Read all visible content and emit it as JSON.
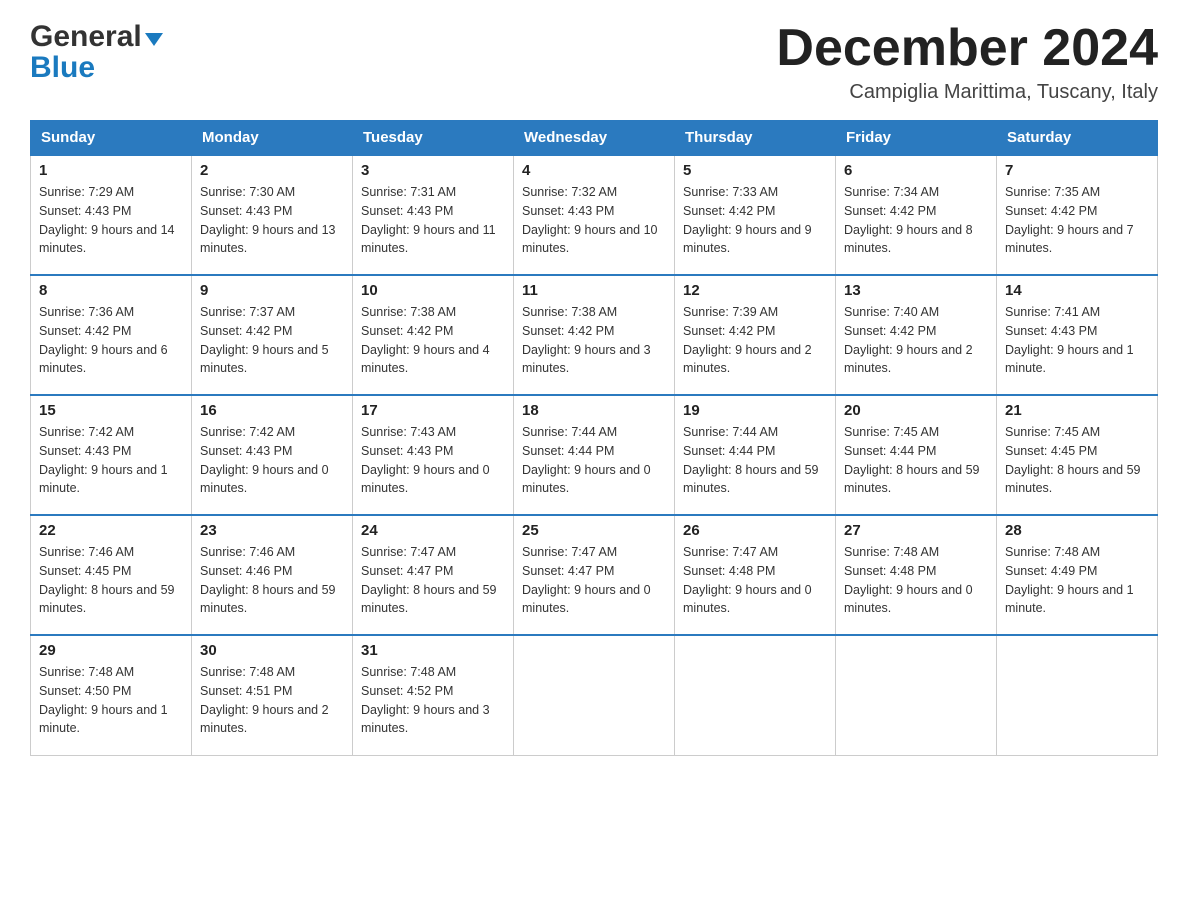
{
  "header": {
    "logo_general": "General",
    "logo_blue": "Blue",
    "month_title": "December 2024",
    "subtitle": "Campiglia Marittima, Tuscany, Italy"
  },
  "days_of_week": [
    "Sunday",
    "Monday",
    "Tuesday",
    "Wednesday",
    "Thursday",
    "Friday",
    "Saturday"
  ],
  "weeks": [
    [
      {
        "day": "1",
        "sunrise": "7:29 AM",
        "sunset": "4:43 PM",
        "daylight": "9 hours and 14 minutes."
      },
      {
        "day": "2",
        "sunrise": "7:30 AM",
        "sunset": "4:43 PM",
        "daylight": "9 hours and 13 minutes."
      },
      {
        "day": "3",
        "sunrise": "7:31 AM",
        "sunset": "4:43 PM",
        "daylight": "9 hours and 11 minutes."
      },
      {
        "day": "4",
        "sunrise": "7:32 AM",
        "sunset": "4:43 PM",
        "daylight": "9 hours and 10 minutes."
      },
      {
        "day": "5",
        "sunrise": "7:33 AM",
        "sunset": "4:42 PM",
        "daylight": "9 hours and 9 minutes."
      },
      {
        "day": "6",
        "sunrise": "7:34 AM",
        "sunset": "4:42 PM",
        "daylight": "9 hours and 8 minutes."
      },
      {
        "day": "7",
        "sunrise": "7:35 AM",
        "sunset": "4:42 PM",
        "daylight": "9 hours and 7 minutes."
      }
    ],
    [
      {
        "day": "8",
        "sunrise": "7:36 AM",
        "sunset": "4:42 PM",
        "daylight": "9 hours and 6 minutes."
      },
      {
        "day": "9",
        "sunrise": "7:37 AM",
        "sunset": "4:42 PM",
        "daylight": "9 hours and 5 minutes."
      },
      {
        "day": "10",
        "sunrise": "7:38 AM",
        "sunset": "4:42 PM",
        "daylight": "9 hours and 4 minutes."
      },
      {
        "day": "11",
        "sunrise": "7:38 AM",
        "sunset": "4:42 PM",
        "daylight": "9 hours and 3 minutes."
      },
      {
        "day": "12",
        "sunrise": "7:39 AM",
        "sunset": "4:42 PM",
        "daylight": "9 hours and 2 minutes."
      },
      {
        "day": "13",
        "sunrise": "7:40 AM",
        "sunset": "4:42 PM",
        "daylight": "9 hours and 2 minutes."
      },
      {
        "day": "14",
        "sunrise": "7:41 AM",
        "sunset": "4:43 PM",
        "daylight": "9 hours and 1 minute."
      }
    ],
    [
      {
        "day": "15",
        "sunrise": "7:42 AM",
        "sunset": "4:43 PM",
        "daylight": "9 hours and 1 minute."
      },
      {
        "day": "16",
        "sunrise": "7:42 AM",
        "sunset": "4:43 PM",
        "daylight": "9 hours and 0 minutes."
      },
      {
        "day": "17",
        "sunrise": "7:43 AM",
        "sunset": "4:43 PM",
        "daylight": "9 hours and 0 minutes."
      },
      {
        "day": "18",
        "sunrise": "7:44 AM",
        "sunset": "4:44 PM",
        "daylight": "9 hours and 0 minutes."
      },
      {
        "day": "19",
        "sunrise": "7:44 AM",
        "sunset": "4:44 PM",
        "daylight": "8 hours and 59 minutes."
      },
      {
        "day": "20",
        "sunrise": "7:45 AM",
        "sunset": "4:44 PM",
        "daylight": "8 hours and 59 minutes."
      },
      {
        "day": "21",
        "sunrise": "7:45 AM",
        "sunset": "4:45 PM",
        "daylight": "8 hours and 59 minutes."
      }
    ],
    [
      {
        "day": "22",
        "sunrise": "7:46 AM",
        "sunset": "4:45 PM",
        "daylight": "8 hours and 59 minutes."
      },
      {
        "day": "23",
        "sunrise": "7:46 AM",
        "sunset": "4:46 PM",
        "daylight": "8 hours and 59 minutes."
      },
      {
        "day": "24",
        "sunrise": "7:47 AM",
        "sunset": "4:47 PM",
        "daylight": "8 hours and 59 minutes."
      },
      {
        "day": "25",
        "sunrise": "7:47 AM",
        "sunset": "4:47 PM",
        "daylight": "9 hours and 0 minutes."
      },
      {
        "day": "26",
        "sunrise": "7:47 AM",
        "sunset": "4:48 PM",
        "daylight": "9 hours and 0 minutes."
      },
      {
        "day": "27",
        "sunrise": "7:48 AM",
        "sunset": "4:48 PM",
        "daylight": "9 hours and 0 minutes."
      },
      {
        "day": "28",
        "sunrise": "7:48 AM",
        "sunset": "4:49 PM",
        "daylight": "9 hours and 1 minute."
      }
    ],
    [
      {
        "day": "29",
        "sunrise": "7:48 AM",
        "sunset": "4:50 PM",
        "daylight": "9 hours and 1 minute."
      },
      {
        "day": "30",
        "sunrise": "7:48 AM",
        "sunset": "4:51 PM",
        "daylight": "9 hours and 2 minutes."
      },
      {
        "day": "31",
        "sunrise": "7:48 AM",
        "sunset": "4:52 PM",
        "daylight": "9 hours and 3 minutes."
      },
      null,
      null,
      null,
      null
    ]
  ]
}
